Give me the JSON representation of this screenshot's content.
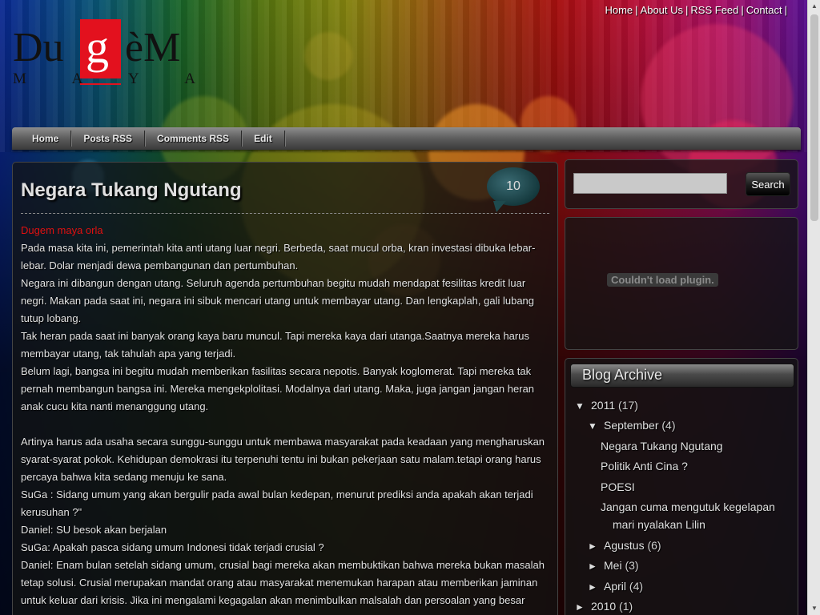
{
  "top_links": [
    "Home",
    "About Us",
    "RSS Feed",
    "Contact"
  ],
  "logo": {
    "left": "Du",
    "g": "g",
    "right": "èM",
    "sub": [
      "M",
      "A",
      "Y",
      "A"
    ]
  },
  "nav": [
    "Home",
    "Posts RSS",
    "Comments RSS",
    "Edit"
  ],
  "post": {
    "title": "Negara Tukang Ngutang",
    "comment_count": "10",
    "label": "Dugem maya orla",
    "paragraphs": [
      "Pada masa kita ini, pemerintah kita anti utang luar negri. Berbeda, saat mucul orba, kran investasi dibuka lebar-lebar. Dolar menjadi dewa pembangunan dan pertumbuhan.",
      "Negara ini dibangun dengan utang. Seluruh agenda pertumbuhan begitu mudah mendapat fesilitas kredit luar negri. Makan pada saat ini, negara ini sibuk mencari utang untuk membayar utang. Dan lengkaplah, gali lubang tutup lobang.",
      "Tak heran pada saat ini banyak orang kaya baru muncul. Tapi mereka kaya dari utanga.Saatnya mereka harus membayar utang, tak tahulah apa yang terjadi.",
      "Belum lagi, bangsa ini begitu mudah memberikan fasilitas secara nepotis. Banyak koglomerat. Tapi mereka tak pernah membangun bangsa ini. Mereka mengekplolitasi. Modalnya dari utang. Maka, juga jangan jangan heran anak cucu kita nanti menanggung utang.",
      "",
      "Artinya harus ada usaha secara sunggu-sunggu untuk membawa masyarakat pada keadaan yang mengharuskan syarat-syarat pokok. Kehidupan demokrasi itu terpenuhi tentu ini bukan pekerjaan satu malam.tetapi orang harus percaya bahwa kita sedang menuju ke sana.",
      "SuGa : Sidang umum yang akan bergulir pada awal bulan kedepan, menurut prediksi anda apakah akan terjadi kerusuhan ?\"",
      "Daniel: SU besok akan berjalan",
      "SuGa: Apakah pasca sidang umum Indonesi tidak terjadi crusial ?",
      "Daniel: Enam bulan setelah sidang umum, crusial bagi mereka akan membuktikan bahwa mereka bukan masalah tetap solusi. Crusial merupakan mandat orang atau masyarakat menemukan harapan atau memberikan jaminan untuk keluar dari krisis. Jika ini mengalami kegagalan akan menimbulkan malsalah dan persoalan yang besar"
    ]
  },
  "search": {
    "button": "Search",
    "value": ""
  },
  "plugin": {
    "message": "Couldn't load plugin."
  },
  "archive": {
    "title": "Blog Archive",
    "rows": [
      {
        "tri": "▼",
        "text": "2011",
        "count": "(17)"
      },
      {
        "tri": "▼",
        "text": "September",
        "count": "(4)"
      },
      {
        "tri": "",
        "text": "Negara Tukang Ngutang",
        "count": ""
      },
      {
        "tri": "",
        "text": "Politik Anti Cina ?",
        "count": ""
      },
      {
        "tri": "",
        "text": "POESI",
        "count": ""
      },
      {
        "tri": "",
        "text": "Jangan cuma mengutuk kegelapan",
        "count": ""
      },
      {
        "tri": "",
        "text": "mari nyalakan Lilin",
        "count": ""
      },
      {
        "tri": "►",
        "text": "Agustus",
        "count": "(6)"
      },
      {
        "tri": "►",
        "text": "Mei",
        "count": "(3)"
      },
      {
        "tri": "►",
        "text": "April",
        "count": "(4)"
      },
      {
        "tri": "►",
        "text": "2010",
        "count": "(1)"
      }
    ]
  },
  "colors": {
    "accent_red": "#e3111e",
    "label_red": "#e01010"
  }
}
